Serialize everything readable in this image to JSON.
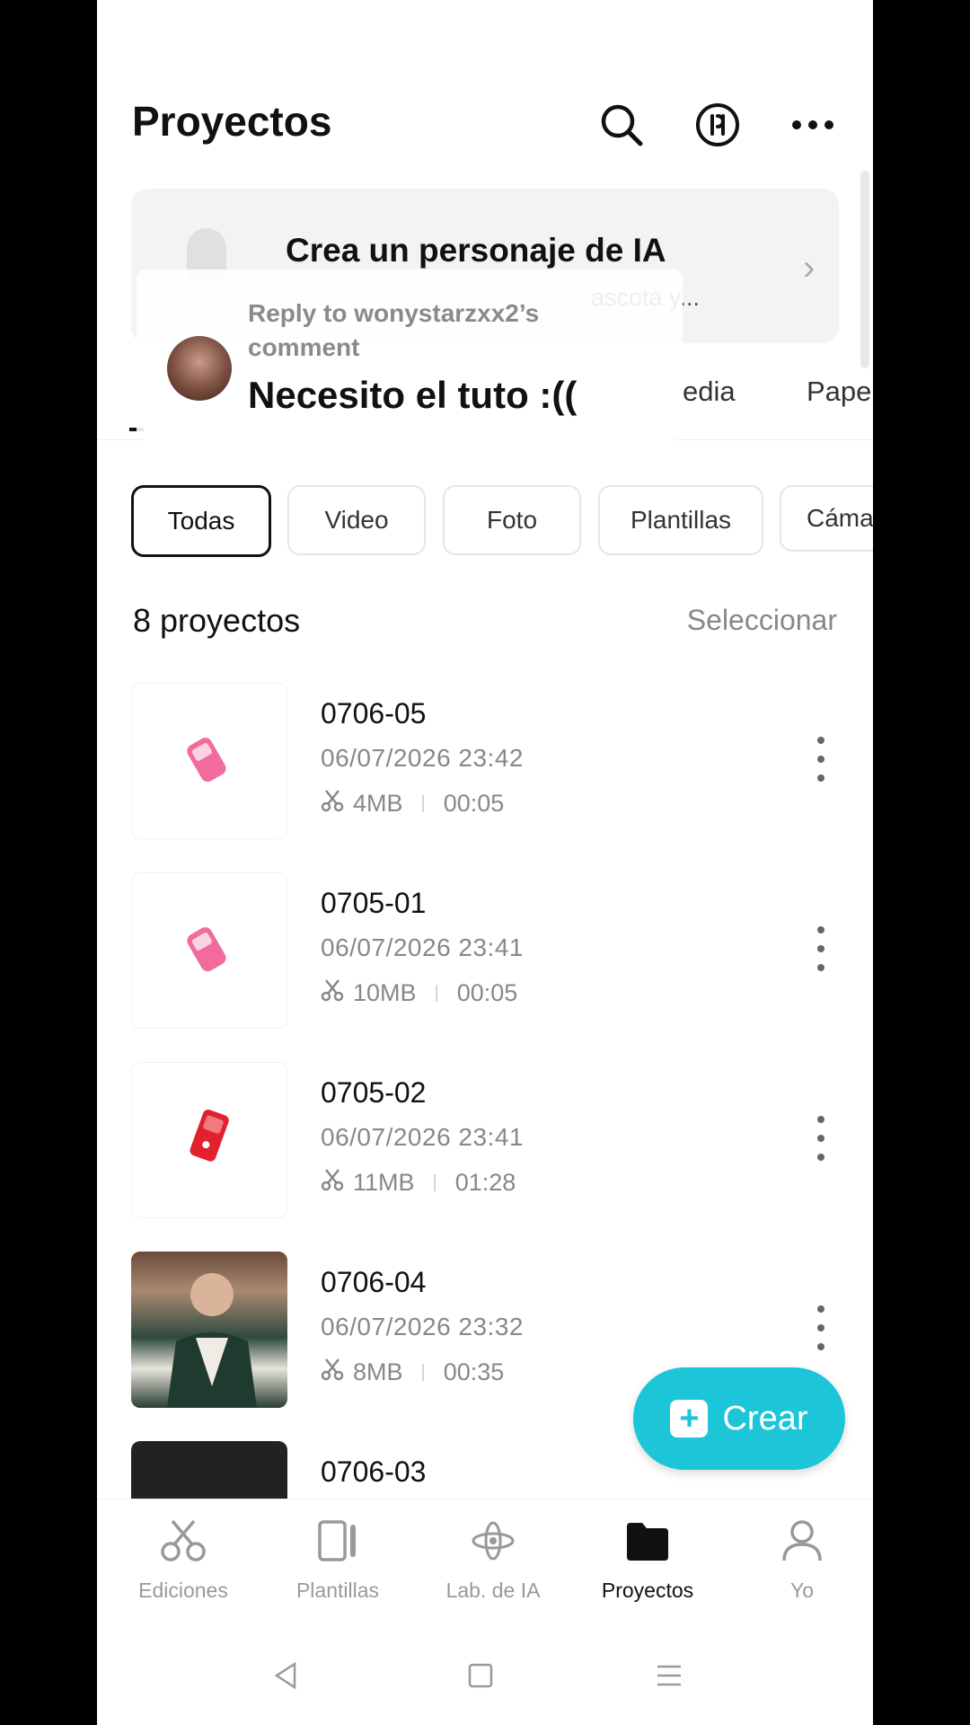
{
  "header": {
    "title": "Proyectos",
    "icons": [
      "search-icon",
      "pro-badge-icon",
      "more-icon"
    ]
  },
  "banner": {
    "title": "Crea un personaje de IA",
    "subtitle": "ascota y..."
  },
  "categories": [
    "edia",
    "Pape"
  ],
  "filters": [
    "Todas",
    "Video",
    "Foto",
    "Plantillas",
    "Cáma"
  ],
  "active_filter": "Todas",
  "list_header": {
    "count": "8 proyectos",
    "select": "Seleccionar"
  },
  "projects": [
    {
      "name": "0706-05",
      "date": "06/07/2026 23:42",
      "size": "4MB",
      "duration": "00:05"
    },
    {
      "name": "0705-01",
      "date": "06/07/2026 23:41",
      "size": "10MB",
      "duration": "00:05"
    },
    {
      "name": "0705-02",
      "date": "06/07/2026 23:41",
      "size": "11MB",
      "duration": "01:28"
    },
    {
      "name": "0706-04",
      "date": "06/07/2026 23:32",
      "size": "8MB",
      "duration": "00:35"
    },
    {
      "name": "0706-03"
    }
  ],
  "fab": {
    "label": "Crear"
  },
  "tabbar": [
    {
      "label": "Ediciones",
      "icon": "scissors-icon"
    },
    {
      "label": "Plantillas",
      "icon": "templates-icon"
    },
    {
      "label": "Lab. de IA",
      "icon": "ai-lab-icon"
    },
    {
      "label": "Proyectos",
      "icon": "folder-icon",
      "active": true
    },
    {
      "label": "Yo",
      "icon": "profile-icon"
    }
  ],
  "overlay": {
    "reply_to": "Reply to wonystarzxx2’s comment",
    "comment": "Necesito el tuto :(("
  },
  "colors": {
    "accent": "#1cc6d8",
    "text": "#111111",
    "muted": "#888888"
  }
}
